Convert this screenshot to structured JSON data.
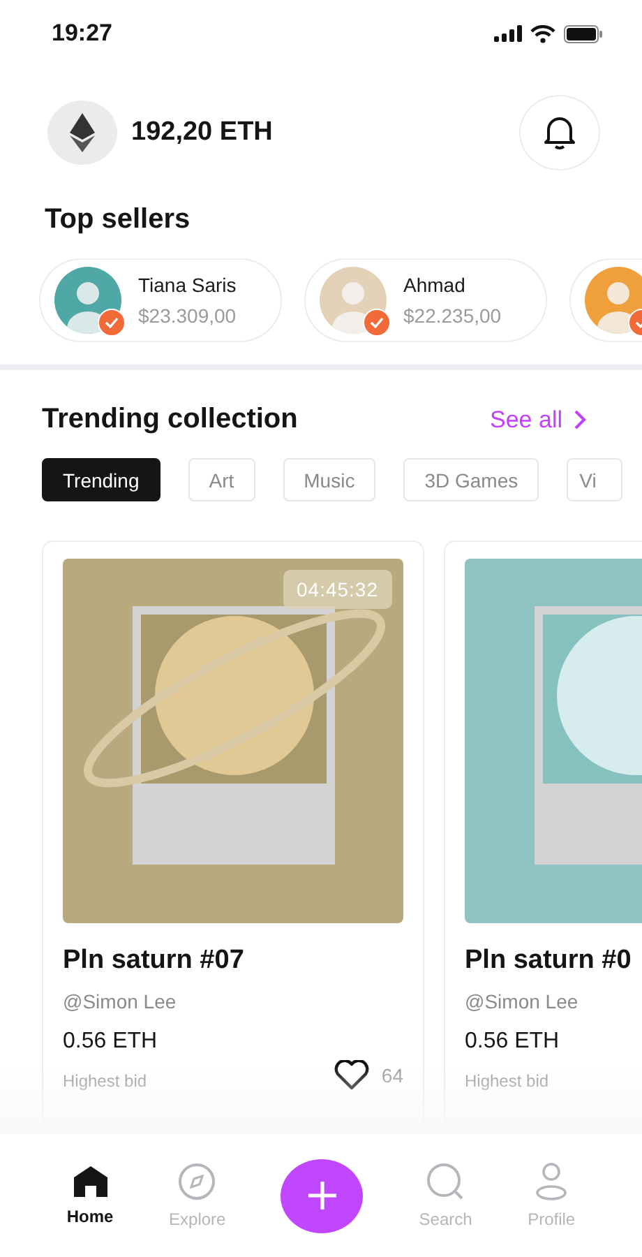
{
  "status_bar": {
    "time": "19:27"
  },
  "wallet": {
    "balance": "192,20 ETH"
  },
  "top_sellers": {
    "title": "Top sellers",
    "sellers": [
      {
        "name": "Tiana Saris",
        "amount": "$23.309,00",
        "verified": true
      },
      {
        "name": "Ahmad",
        "amount": "$22.235,00",
        "verified": true
      },
      {
        "verified": true
      }
    ]
  },
  "trending": {
    "title": "Trending collection",
    "see_all": "See all",
    "tabs": [
      {
        "label": "Trending",
        "selected": true
      },
      {
        "label": "Art",
        "selected": false
      },
      {
        "label": "Music",
        "selected": false
      },
      {
        "label": "3D Games",
        "selected": false
      },
      {
        "label": "Vi",
        "selected": false
      }
    ],
    "cards": [
      {
        "kind": "saturn",
        "timer": "04:45:32",
        "title": "Pln saturn #07",
        "author": "@Simon Lee",
        "price": "0.56 ETH",
        "price_label": "Highest bid",
        "likes": "64"
      },
      {
        "kind": "uranus",
        "title": "Pln saturn #0",
        "author": "@Simon Lee",
        "price": "0.56 ETH",
        "price_label": "Highest bid"
      }
    ]
  },
  "bottom_nav": [
    {
      "kind": "tab",
      "label": "Home",
      "selected": true
    },
    {
      "kind": "tab",
      "label": "Explore",
      "selected": false
    },
    {
      "kind": "add"
    },
    {
      "kind": "tab",
      "label": "Search",
      "selected": false
    },
    {
      "kind": "tab",
      "label": "Profile",
      "selected": false
    }
  ]
}
